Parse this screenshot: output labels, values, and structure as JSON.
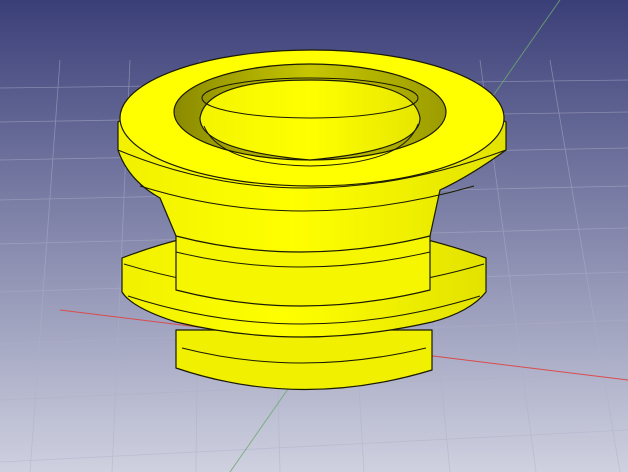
{
  "viewport": {
    "background_top": "#3b3f78",
    "background_bottom": "#c9cbdc",
    "grid_color": "#a9abc4",
    "axis_x_color": "#d94c4c",
    "axis_y_color": "#6fa86f",
    "model_color": "#ffff00",
    "model_shade_color": "#b8b800",
    "edge_color": "#1a1a00"
  },
  "scene": {
    "object": "flanged grommet",
    "view": "axonometric",
    "grid_visible": true
  }
}
